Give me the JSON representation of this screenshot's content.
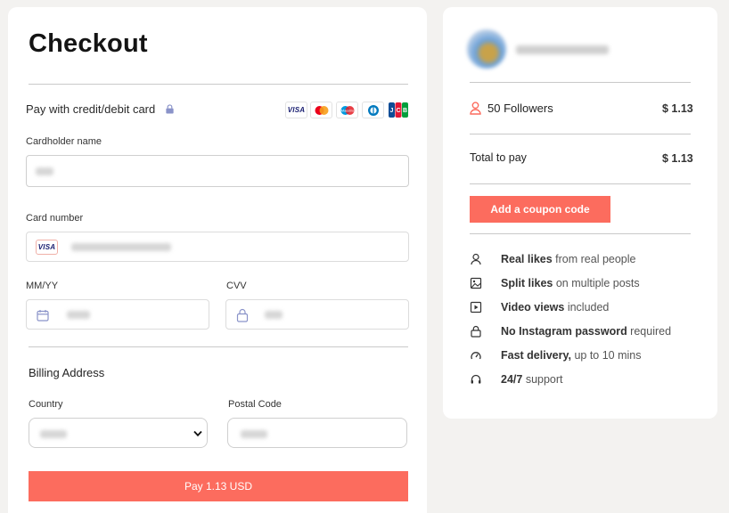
{
  "checkout": {
    "title": "Checkout",
    "pay_with": "Pay with credit/debit card",
    "card_brands": [
      "VISA",
      "Mastercard",
      "Maestro",
      "Diners",
      "JCB"
    ],
    "cardholder_label": "Cardholder name",
    "card_number_label": "Card number",
    "card_badge": "VISA",
    "expiry_label": "MM/YY",
    "cvv_label": "CVV",
    "billing_title": "Billing Address",
    "country_label": "Country",
    "postal_label": "Postal Code",
    "pay_button": "Pay 1.13 USD"
  },
  "summary": {
    "item_label": "50 Followers",
    "item_price": "$ 1.13",
    "total_label": "Total to pay",
    "total_price": "$ 1.13",
    "coupon_button": "Add a coupon code",
    "features": [
      {
        "icon": "user-icon",
        "bold": "Real likes",
        "rest": " from real people"
      },
      {
        "icon": "image-icon",
        "bold": "Split likes",
        "rest": " on multiple posts"
      },
      {
        "icon": "play-icon",
        "bold": "Video views",
        "rest": " included"
      },
      {
        "icon": "lock-icon",
        "bold": "No Instagram password",
        "rest": " required"
      },
      {
        "icon": "speedometer-icon",
        "bold": "Fast delivery,",
        "rest": " up to 10 mins"
      },
      {
        "icon": "headset-icon",
        "bold": "24/7",
        "rest": " support"
      }
    ]
  },
  "colors": {
    "accent": "#fc6c5e",
    "background": "#f3f2f0",
    "card": "#ffffff"
  }
}
